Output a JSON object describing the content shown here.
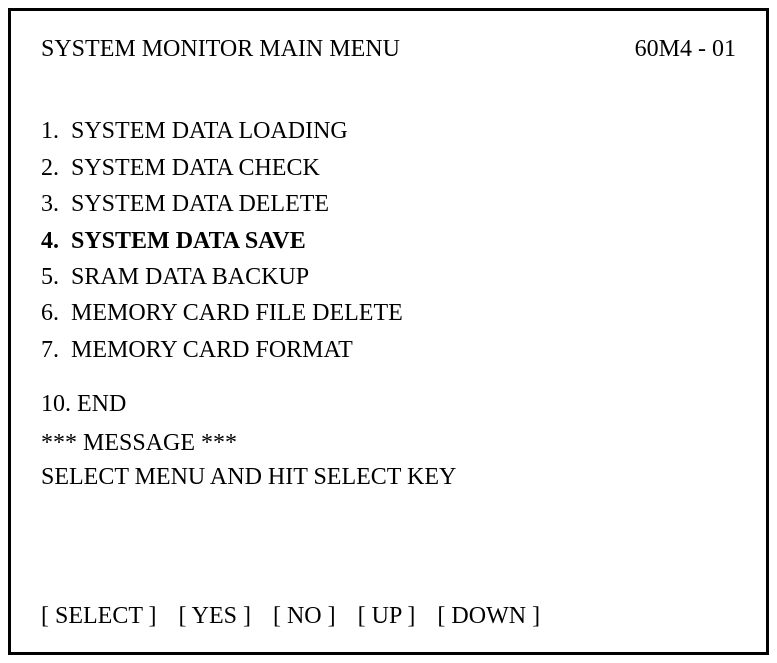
{
  "header": {
    "title": "SYSTEM MONITOR MAIN MENU",
    "code": "60M4 - 01"
  },
  "menu": {
    "items": [
      {
        "num": "1.",
        "label": "SYSTEM DATA LOADING",
        "selected": false
      },
      {
        "num": "2.",
        "label": "SYSTEM DATA CHECK",
        "selected": false
      },
      {
        "num": "3.",
        "label": "SYSTEM DATA DELETE",
        "selected": false
      },
      {
        "num": "4.",
        "label": "SYSTEM DATA SAVE",
        "selected": true
      },
      {
        "num": "5.",
        "label": "SRAM DATA BACKUP",
        "selected": false
      },
      {
        "num": "6.",
        "label": "MEMORY CARD FILE DELETE",
        "selected": false
      },
      {
        "num": "7.",
        "label": "MEMORY CARD FORMAT",
        "selected": false
      }
    ],
    "end": {
      "num": "10.",
      "label": "END"
    }
  },
  "message": {
    "header": "*** MESSAGE ***",
    "text": "SELECT MENU AND HIT SELECT KEY"
  },
  "buttons": {
    "select": "[ SELECT ]",
    "yes": "[ YES ]",
    "no": "[  NO  ]",
    "up": "[  UP  ]",
    "down": "[ DOWN ]"
  }
}
